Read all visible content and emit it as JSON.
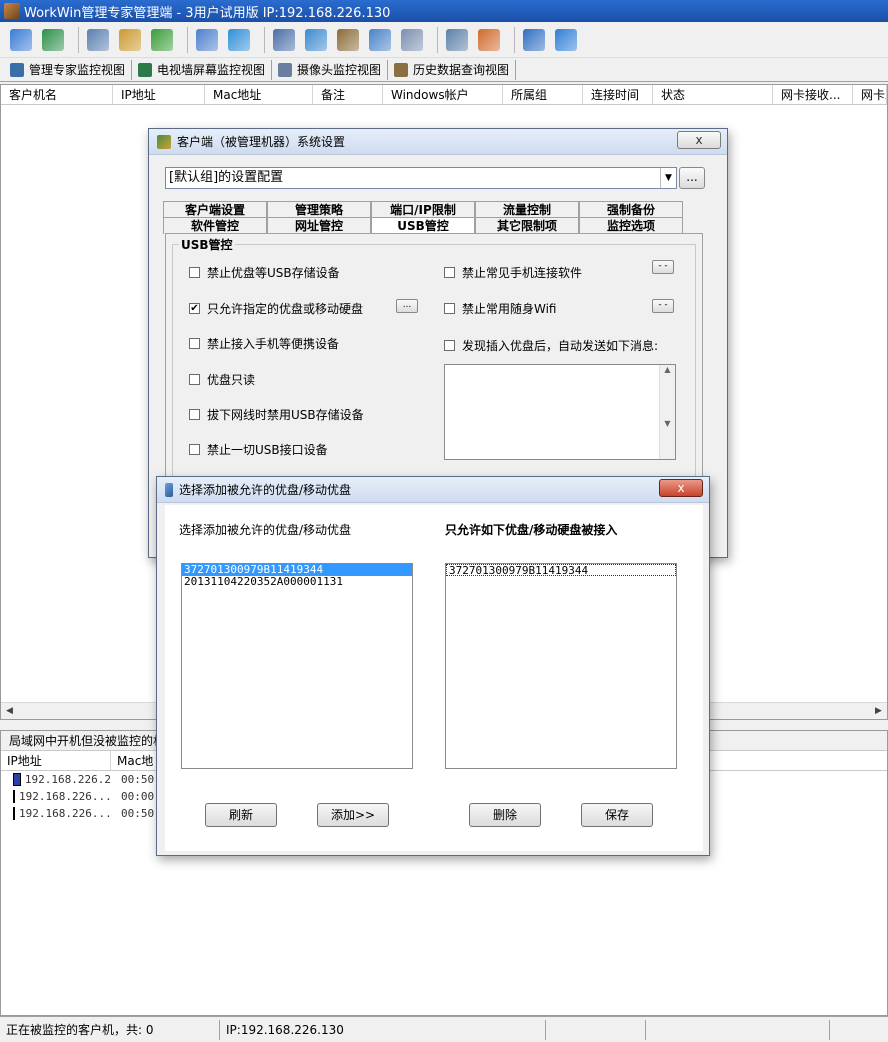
{
  "app": {
    "title": "WorkWin管理专家管理端 - 3用户试用版 IP:192.168.226.130"
  },
  "toolbar": {
    "buttons": [
      {
        "icon": "layers-icon",
        "color": "#3a7bd5"
      },
      {
        "icon": "globe-icon",
        "color": "#2c8f4a"
      },
      {
        "icon": "monitor-settings-icon",
        "color": "#5a7fb0"
      },
      {
        "icon": "mail-icon",
        "color": "#c99a2e"
      },
      {
        "icon": "users-icon",
        "color": "#3a9c3a"
      },
      {
        "icon": "chart-icon",
        "color": "#4d7fcf"
      },
      {
        "icon": "info-icon",
        "color": "#2f8fd8"
      },
      {
        "icon": "computer-icon",
        "color": "#4a6ea8"
      },
      {
        "icon": "refresh-icon",
        "color": "#3c8ad0"
      },
      {
        "icon": "search-document-icon",
        "color": "#8a6c38"
      },
      {
        "icon": "windows-icon",
        "color": "#4a83c7"
      },
      {
        "icon": "disc-icon",
        "color": "#7a8fb0"
      },
      {
        "icon": "document-list-icon",
        "color": "#5c7fa8"
      },
      {
        "icon": "user-card-icon",
        "color": "#d06a2e"
      },
      {
        "icon": "cart-icon",
        "color": "#2f6fc2"
      },
      {
        "icon": "help-icon",
        "color": "#2f7fd8"
      }
    ]
  },
  "viewtabs": [
    {
      "label": "管理专家监控视图",
      "icon": "monitor-icon",
      "color": "#3a6ea8"
    },
    {
      "label": "电视墙屏幕监控视图",
      "icon": "tv-wall-icon",
      "color": "#2c7a4a"
    },
    {
      "label": "摄像头监控视图",
      "icon": "camera-icon",
      "color": "#6a7fa0"
    },
    {
      "label": "历史数据查询视图",
      "icon": "history-icon",
      "color": "#8a7040"
    }
  ],
  "main_list": {
    "columns": [
      "客户机名",
      "IP地址",
      "Mac地址",
      "备注",
      "Windows帐户",
      "所属组",
      "连接时间",
      "状态",
      "网卡接收...",
      "网卡发"
    ]
  },
  "lower_panel": {
    "title": "局域网中开机但没被监控的机",
    "columns": [
      "IP地址",
      "Mac地"
    ],
    "rows": [
      {
        "ip": "192.168.226.2",
        "mac": "00:50"
      },
      {
        "ip": "192.168.226...",
        "mac": "00:00"
      },
      {
        "ip": "192.168.226...",
        "mac": "00:50"
      }
    ]
  },
  "statusbar": {
    "count_text": "正在被监控的客户机，共: 0",
    "ip_text": "IP:192.168.226.130"
  },
  "settings_dialog": {
    "title": "客户端（被管理机器）系统设置",
    "config_select": "[默认组]的设置配置",
    "more_label": "...",
    "close_label": "x",
    "tabs_row1": [
      "客户端设置",
      "管理策略",
      "端口/IP限制",
      "流量控制",
      "强制备份"
    ],
    "tabs_row2": [
      "软件管控",
      "网址管控",
      "USB管控",
      "其它限制项",
      "监控选项"
    ],
    "active_tab": "USB管控",
    "group_label": "USB管控",
    "left_options": [
      {
        "label": "禁止优盘等USB存储设备",
        "checked": false
      },
      {
        "label": "只允许指定的优盘或移动硬盘",
        "checked": true
      },
      {
        "label": "禁止接入手机等便携设备",
        "checked": false
      },
      {
        "label": "优盘只读",
        "checked": false
      },
      {
        "label": "拔下网线时禁用USB存储设备",
        "checked": false
      },
      {
        "label": "禁止一切USB接口设备",
        "checked": false
      }
    ],
    "right_options": [
      {
        "label": "禁止常见手机连接软件",
        "checked": false
      },
      {
        "label": "禁止常用随身Wifi",
        "checked": false
      },
      {
        "label": "发现插入优盘后，自动发送如下消息:",
        "checked": false
      }
    ],
    "small_btn_label": "...",
    "dots_btn_label": "- -"
  },
  "usb_dialog": {
    "title": "选择添加被允许的优盘/移动优盘",
    "close_label": "x",
    "left_label": "选择添加被允许的优盘/移动优盘",
    "right_label": "只允许如下优盘/移动硬盘被接入",
    "left_items": [
      "372701300979B11419344",
      "20131104220352A000001131"
    ],
    "right_items": [
      "372701300979B11419344"
    ],
    "buttons": {
      "refresh": "刷新",
      "add": "添加>>",
      "delete": "删除",
      "save": "保存"
    }
  }
}
